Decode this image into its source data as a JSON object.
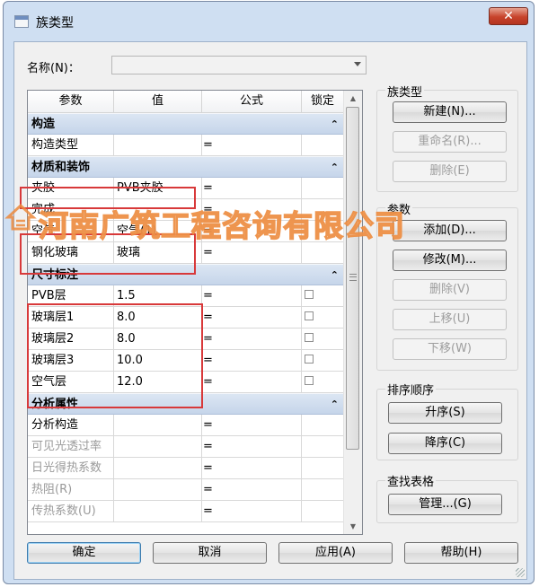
{
  "window": {
    "title": "族类型",
    "close_label": "✕"
  },
  "name_field": {
    "label": "名称(N)：",
    "value": ""
  },
  "grid": {
    "columns": [
      "参数",
      "值",
      "公式",
      "锁定"
    ],
    "groups": [
      {
        "title": "构造",
        "rows": [
          {
            "param": "构造类型",
            "value": "",
            "formula": "="
          }
        ]
      },
      {
        "title": "材质和装饰",
        "rows": [
          {
            "param": "夹胶",
            "value": "PVB夹胶",
            "formula": "="
          },
          {
            "param": "完成",
            "value": "",
            "formula": "="
          },
          {
            "param": "空气",
            "value": "空气(1)",
            "formula": "="
          },
          {
            "param": "钢化玻璃",
            "value": "玻璃",
            "formula": "="
          }
        ]
      },
      {
        "title": "尺寸标注",
        "rows": [
          {
            "param": "PVB层",
            "value": "1.5",
            "formula": "="
          },
          {
            "param": "玻璃层1",
            "value": "8.0",
            "formula": "="
          },
          {
            "param": "玻璃层2",
            "value": "8.0",
            "formula": "="
          },
          {
            "param": "玻璃层3",
            "value": "10.0",
            "formula": "="
          },
          {
            "param": "空气层",
            "value": "12.0",
            "formula": "="
          }
        ]
      },
      {
        "title": "分析属性",
        "rows": [
          {
            "param": "分析构造",
            "value": "",
            "formula": "="
          },
          {
            "param": "可见光透过率",
            "value": "",
            "formula": "="
          },
          {
            "param": "日光得热系数",
            "value": "",
            "formula": "="
          },
          {
            "param": "热阻(R)",
            "value": "",
            "formula": "="
          },
          {
            "param": "传热系数(U)",
            "value": "",
            "formula": "="
          }
        ]
      }
    ]
  },
  "panel_family_types": {
    "title": "族类型",
    "new": "新建(N)...",
    "rename": "重命名(R)...",
    "delete": "删除(E)"
  },
  "panel_params": {
    "title": "参数",
    "add": "添加(D)...",
    "modify": "修改(M)...",
    "delete": "删除(V)",
    "move_up": "上移(U)",
    "move_down": "下移(W)"
  },
  "panel_sort": {
    "title": "排序顺序",
    "asc": "升序(S)",
    "desc": "降序(C)"
  },
  "panel_lookup": {
    "title": "查找表格",
    "manage": "管理...(G)"
  },
  "footer": {
    "ok": "确定",
    "cancel": "取消",
    "apply": "应用(A)",
    "help": "帮助(H)"
  },
  "watermark": {
    "text": "河南广筑工程咨询有限公司"
  },
  "colors": {
    "highlight": "#d8393a",
    "group_header": "#c6d5ea",
    "watermark_stroke": "#ec8a3c"
  }
}
